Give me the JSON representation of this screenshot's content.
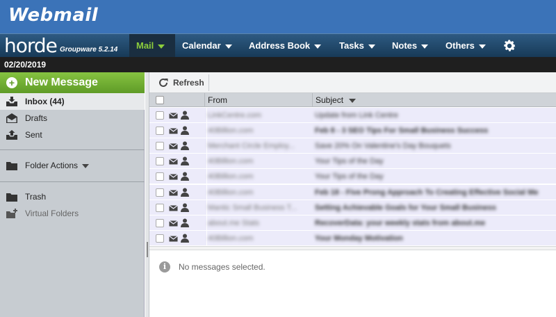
{
  "banner": {
    "logo_text": "Webmail"
  },
  "horde": {
    "logo_word": "horde",
    "product": "Groupware 5.2.14"
  },
  "menu": {
    "items": [
      {
        "label": "Mail",
        "active": true
      },
      {
        "label": "Calendar"
      },
      {
        "label": "Address Book"
      },
      {
        "label": "Tasks"
      },
      {
        "label": "Notes"
      },
      {
        "label": "Others"
      }
    ],
    "settings_icon": "gear-icon"
  },
  "date": "02/20/2019",
  "sidebar": {
    "new_message": "New Message",
    "folders": [
      {
        "label": "Inbox (44)",
        "icon": "inbox-icon",
        "selected": true
      },
      {
        "label": "Drafts",
        "icon": "drafts-icon"
      },
      {
        "label": "Sent",
        "icon": "sent-icon"
      }
    ],
    "folder_actions": "Folder Actions",
    "trash": "Trash",
    "virtual_folders": "Virtual Folders"
  },
  "toolbar": {
    "refresh": "Refresh"
  },
  "list": {
    "columns": {
      "from": "From",
      "subject": "Subject"
    },
    "rows": [
      {
        "from": "LinkCentre.com",
        "subject": "Update from Link Centre",
        "bold": false
      },
      {
        "from": "40Billion.com",
        "subject": "Feb 8 - 3 SEO Tips For Small Business Success",
        "bold": true
      },
      {
        "from": "Merchant Circle Employ...",
        "subject": "Save 20% On Valentine's Day Bouquets",
        "bold": false
      },
      {
        "from": "40Billion.com",
        "subject": "Your Tips of the Day",
        "bold": false
      },
      {
        "from": "40Billion.com",
        "subject": "Your Tips of the Day",
        "bold": false
      },
      {
        "from": "40Billion.com",
        "subject": "Feb 18 - Five Prong Approach To Creating Effective Social Me",
        "bold": true
      },
      {
        "from": "Mantic Small Business T...",
        "subject": "Setting Achievable Goals for Your Small Business",
        "bold": true
      },
      {
        "from": "about.me Stats",
        "subject": "RecoverData: your weekly stats from about.me",
        "bold": true
      },
      {
        "from": "40Billion.com",
        "subject": "Your Monday Motivation",
        "bold": true
      }
    ]
  },
  "preview": {
    "empty": "No messages selected."
  }
}
